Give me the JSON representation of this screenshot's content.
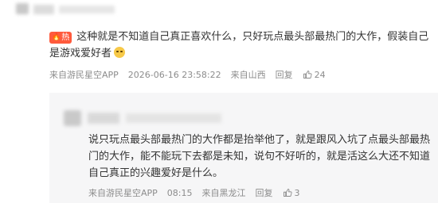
{
  "main_comment": {
    "badge_label": "热",
    "text": "这种就是不知道自己真正喜欢什么，只好玩点最头部最热门的大作，假装自己是游戏爱好者",
    "emoji": "smirk-face",
    "source": "来自游民星空APP",
    "timestamp": "2026-06-16 23:58:22",
    "location": "来自山西",
    "reply_label": "回复",
    "like_count": "24"
  },
  "reply": {
    "text": "说只玩点最头部最热门的大作都是抬举他了，就是跟风入坑了点最头部最热门的大作，能不能玩下去都是未知，说句不好听的，就是活这么大还不知道自己真正的兴趣爱好是什么。",
    "source": "来自游民星空APP",
    "time": "08:15",
    "location": "来自黑龙江",
    "reply_label": "回复",
    "like_count": "3"
  },
  "colors": {
    "hot_badge": "#ff5a3c",
    "meta_text": "#8c8c8c",
    "reply_bg": "#f6f6f7"
  }
}
